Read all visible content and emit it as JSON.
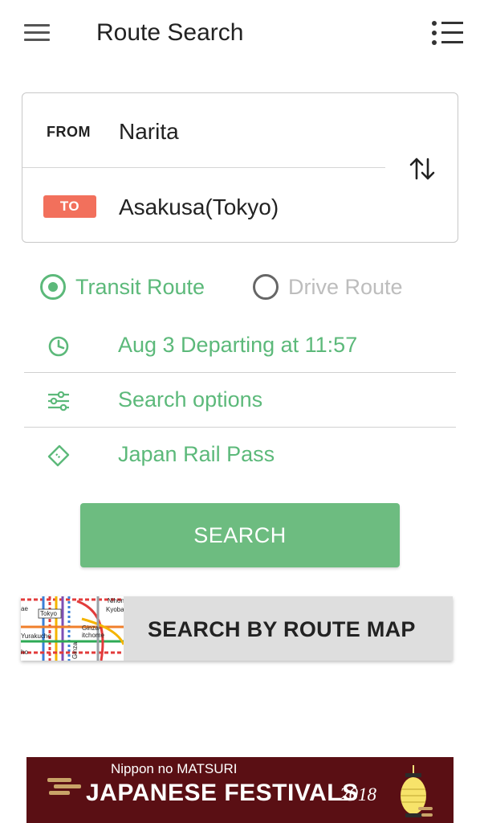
{
  "header": {
    "title": "Route Search"
  },
  "route": {
    "from_tag": "FROM",
    "from_value": "Narita",
    "to_tag": "TO",
    "to_value": "Asakusa(Tokyo)",
    "to_tag_color": "#f2705c"
  },
  "mode": {
    "options": [
      {
        "label": "Transit Route",
        "selected": true
      },
      {
        "label": "Drive Route",
        "selected": false
      }
    ]
  },
  "options": [
    {
      "label": "Aug 3 Departing at 11:57",
      "icon": "clock-icon"
    },
    {
      "label": "Search options",
      "icon": "sliders-icon"
    },
    {
      "label": "Japan Rail Pass",
      "icon": "ticket-icon"
    }
  ],
  "actions": {
    "search_label": "SEARCH",
    "route_map_label": "SEARCH BY ROUTE MAP"
  },
  "route_map_thumb": {
    "labels": [
      "Tokyo",
      "Nihon",
      "Kyoba",
      "Ginza-",
      "itchome",
      "Yurakucho",
      "Ginza",
      "ae",
      "ho"
    ]
  },
  "banner": {
    "subtitle": "Nippon no MATSURI",
    "title": "JAPANESE FESTIVALS",
    "year": "2018"
  },
  "colors": {
    "accent_green": "#5cb97a",
    "button_green": "#6dbc80",
    "banner_bg": "#5a0f14"
  }
}
